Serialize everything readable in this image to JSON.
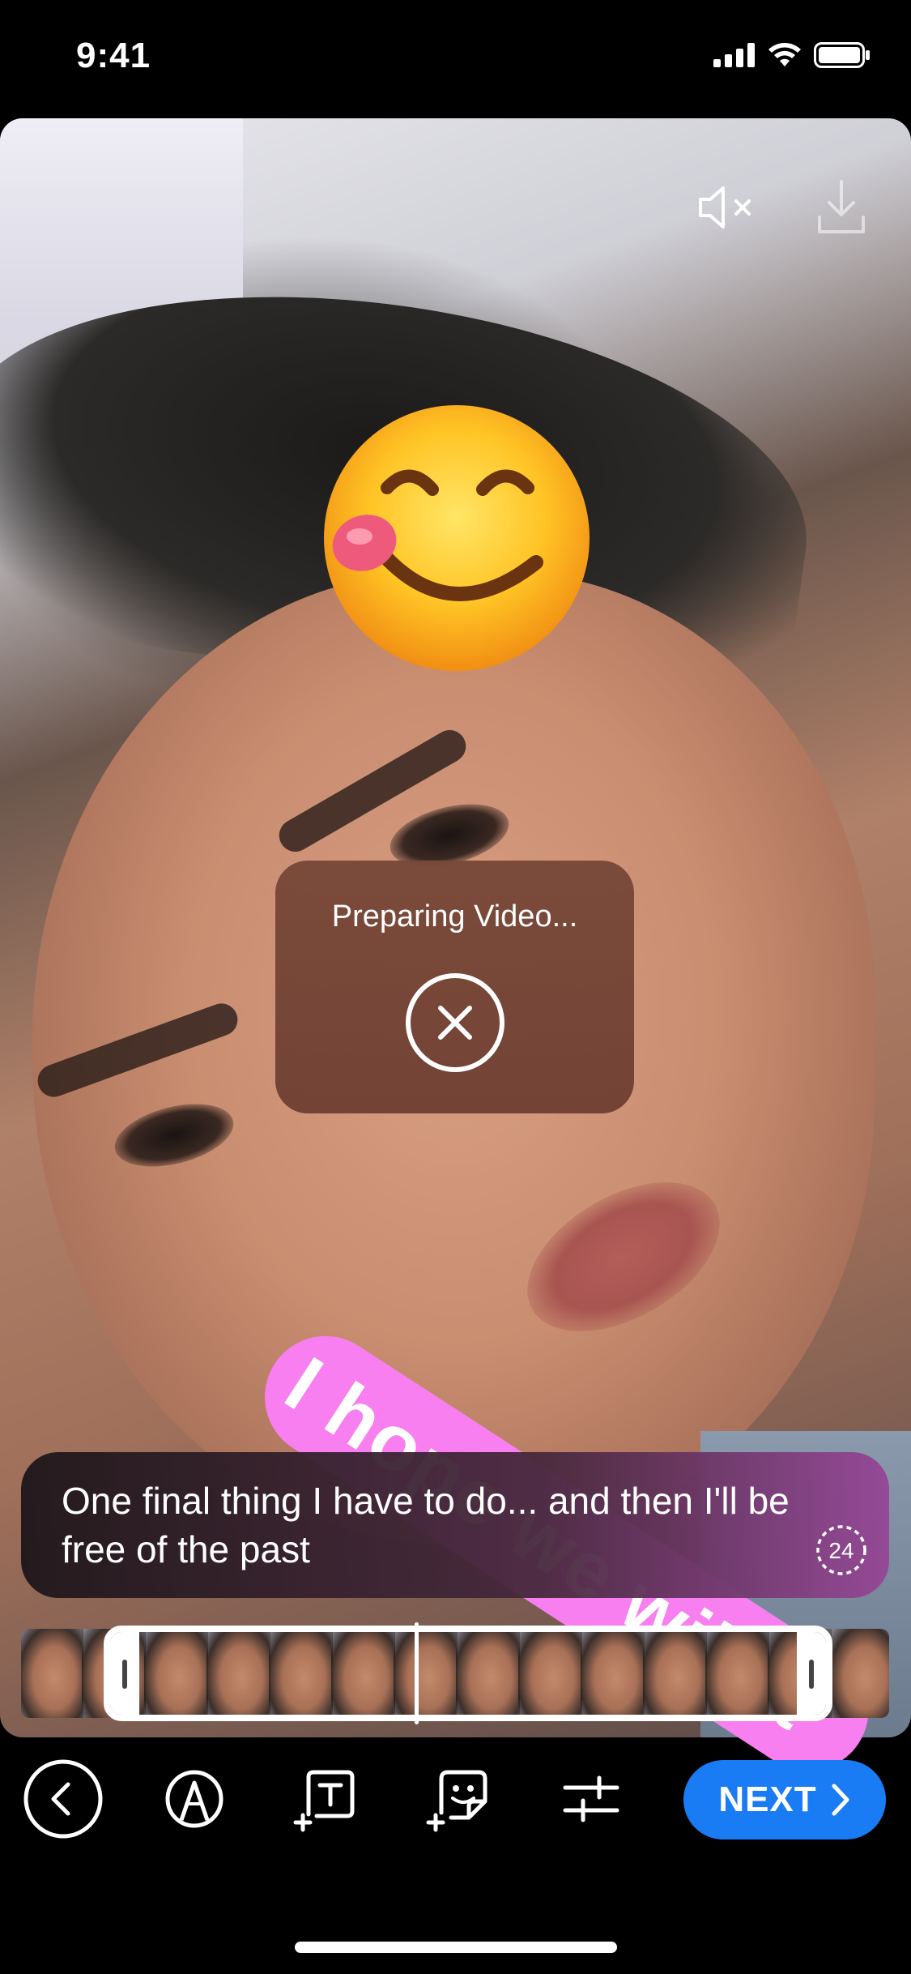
{
  "status_bar": {
    "time": "9:41"
  },
  "editor": {
    "processing_dialog": {
      "title": "Preparing Video..."
    },
    "text_sticker": {
      "text": "I hope we will, t"
    },
    "caption": {
      "text": "One final thing I have to do... and then I'll be free of the past",
      "badge": "24"
    },
    "timeline": {
      "frame_count": 14
    }
  },
  "toolbar": {
    "next_label": "NEXT"
  },
  "colors": {
    "accent": "#1a7cf5",
    "sticker_pink": "#f77fef",
    "dialog_bg": "#784838"
  },
  "icons": [
    "mute-icon",
    "download-icon",
    "close-icon",
    "back-icon",
    "draw-icon",
    "text-icon",
    "sticker-icon",
    "adjust-icon",
    "chevron-right-icon"
  ]
}
